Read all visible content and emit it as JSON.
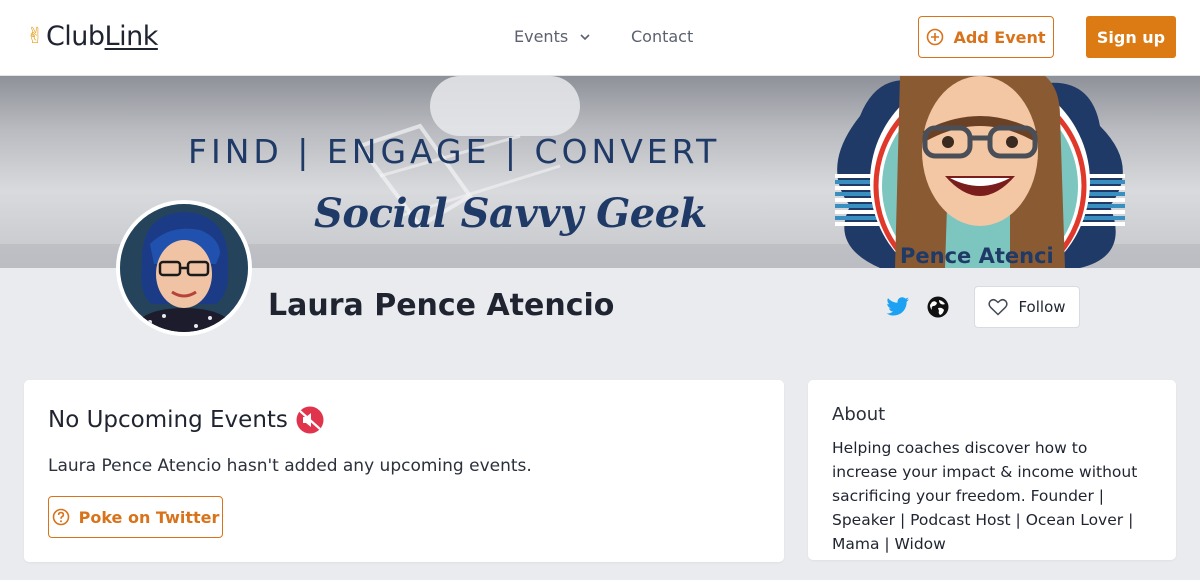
{
  "header": {
    "logo_text_a": "Club",
    "logo_text_b": "Link",
    "nav": {
      "events_label": "Events",
      "contact_label": "Contact"
    },
    "add_event_label": "Add Event",
    "signup_label": "Sign up"
  },
  "banner": {
    "tagline": "FIND | ENGAGE | CONVERT",
    "brand": "Social Savvy Geek",
    "name_arc": "Pence Atenci"
  },
  "profile": {
    "name": "Laura Pence Atencio",
    "follow_label": "Follow",
    "social_icons": [
      "twitter-icon",
      "globe-icon"
    ]
  },
  "events_card": {
    "title": "No Upcoming Events",
    "message": "Laura Pence Atencio hasn't added any upcoming events.",
    "poke_label": "Poke on Twitter"
  },
  "about_card": {
    "title": "About",
    "text": "Helping coaches discover how to increase your impact & income without sacrificing your freedom. Founder | Speaker | Podcast Host | Ocean Lover | Mama | Widow"
  },
  "colors": {
    "accent": "#dc7a14",
    "twitter": "#1da1f2",
    "banner_text": "#1f3a67",
    "background": "#e9ebef"
  }
}
